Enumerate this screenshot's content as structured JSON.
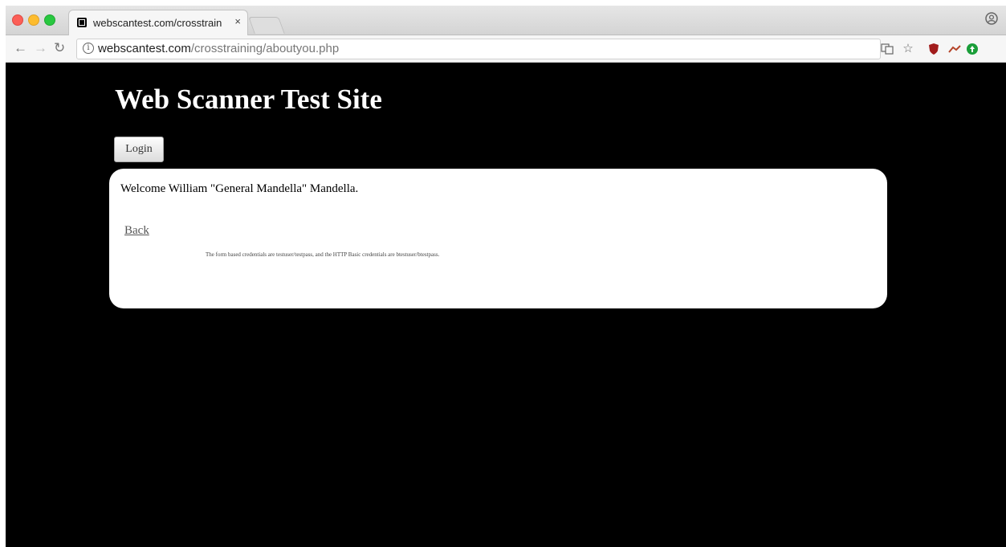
{
  "browser": {
    "tab_title": "webscantest.com/crosstrainin",
    "tab_close": "×",
    "url_domain": "webscantest.com",
    "url_path": "/crosstraining/aboutyou.php",
    "icons": {
      "back": "back-arrow-icon",
      "forward": "forward-arrow-icon",
      "reload": "reload-icon",
      "info": "info-icon",
      "translate": "translate-icon",
      "star": "bookmark-star-icon",
      "shield": "ublock-shield-icon",
      "profile": "profile-icon"
    }
  },
  "page": {
    "site_title": "Web Scanner Test Site",
    "login_label": "Login",
    "welcome_text": "Welcome William \"General Mandella\" Mandella.",
    "back_link": "Back",
    "credentials_note": "The form based credentials are testuser/testpass, and the HTTP Basic credentials are btestuser/btestpass."
  },
  "colors": {
    "page_background": "#000000",
    "card_background": "#ffffff",
    "title_color": "#ffffff"
  }
}
